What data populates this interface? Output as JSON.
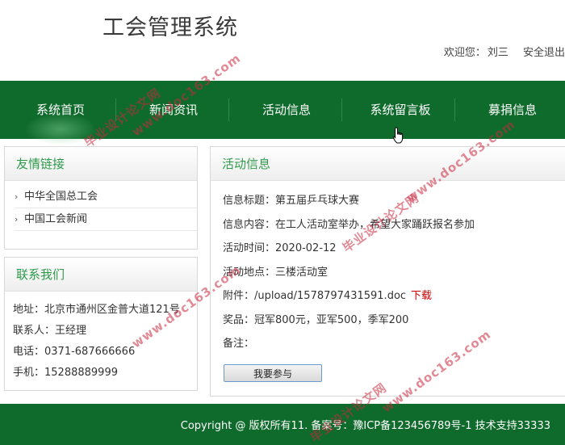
{
  "header": {
    "title": "工会管理系统",
    "welcome_label": "欢迎您：",
    "user_name": "刘三",
    "logout_label": "安全退出"
  },
  "nav": {
    "items": [
      {
        "label": "系统首页"
      },
      {
        "label": "新闻资讯"
      },
      {
        "label": "活动信息"
      },
      {
        "label": "系统留言板"
      },
      {
        "label": "募捐信息"
      }
    ]
  },
  "links_panel": {
    "title": "友情链接",
    "items": [
      "中华全国总工会",
      "中国工会新闻"
    ]
  },
  "contact_panel": {
    "title": "联系我们",
    "address": "地址：北京市通州区金普大道121号",
    "contact_person": "联系人：王经理",
    "phone": "电话：0371-687666666",
    "mobile": "手机：15288889999"
  },
  "activity": {
    "title": "活动信息",
    "info_title": "信息标题：第五届乒乓球大赛",
    "info_content": "信息内容：在工人活动室举办，希望大家踊跃报名参加",
    "time": "活动时间：2020-02-12",
    "location": "活动地点：三楼活动室",
    "attachment": "附件：/upload/1578797431591.doc",
    "download_label": "下载",
    "prize": "奖品：冠军800元，亚军500，季军200",
    "remark": "备注：",
    "join_button_label": "我要参与"
  },
  "footer": {
    "text": "Copyright @ 版权所有11. 备案号：豫ICP备123456789号-1   技术支持33333"
  },
  "watermarks": [
    "毕业设计论文网",
    "www.doc163.com"
  ],
  "colors": {
    "brand_green": "#0f6b2c",
    "panel_title_green": "#2f9a4c",
    "download_red": "#cc0000",
    "watermark_red": "#c8283c"
  }
}
